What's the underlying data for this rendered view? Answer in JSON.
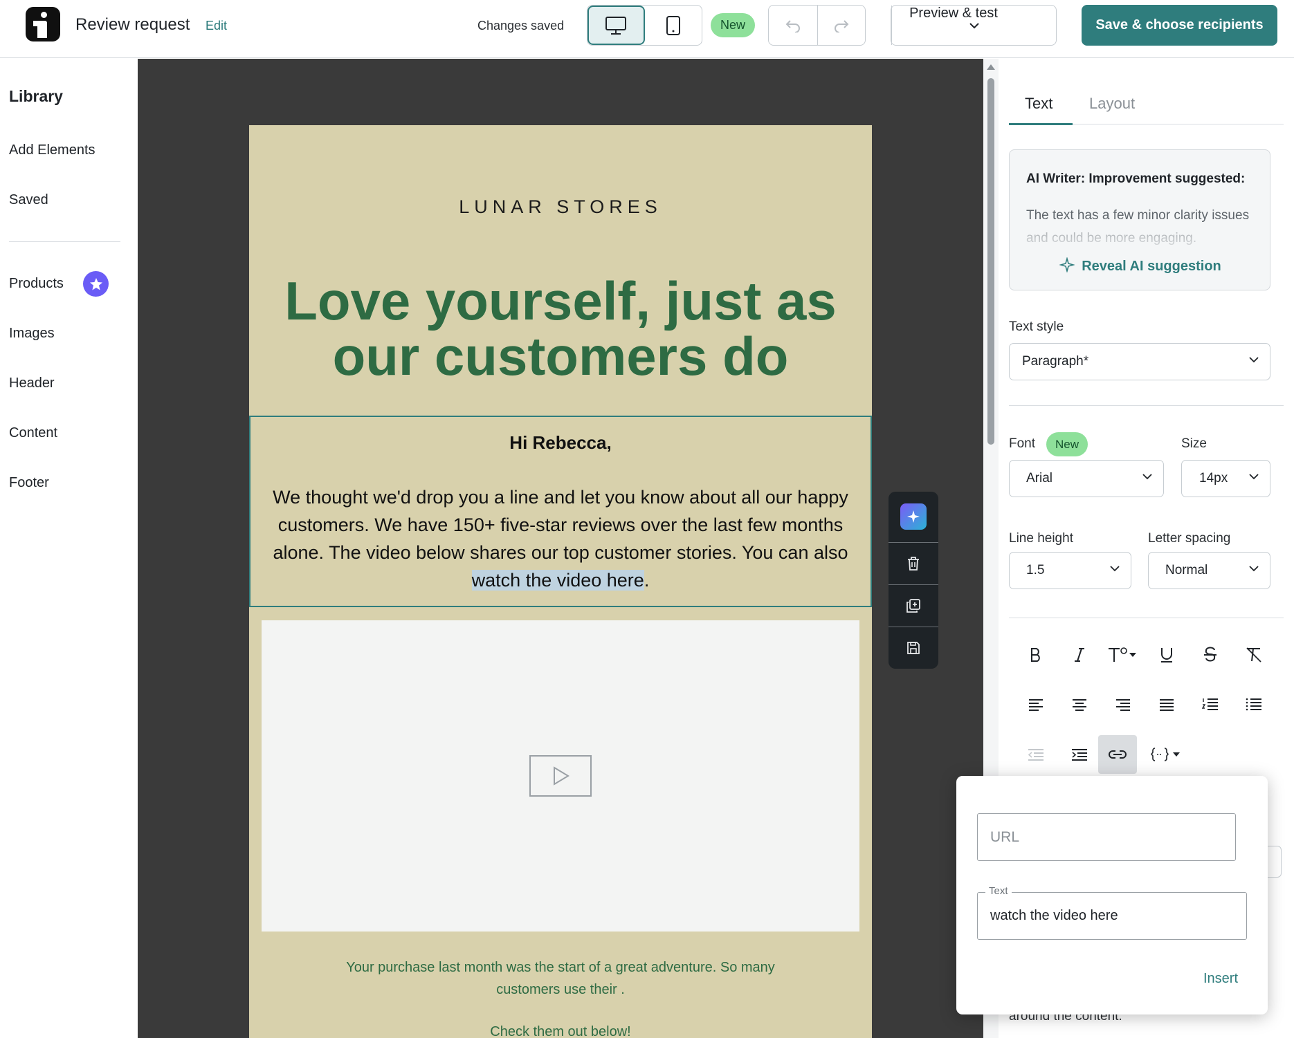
{
  "header": {
    "title": "Review request",
    "edit_label": "Edit",
    "status": "Changes saved",
    "new_badge": "New",
    "preview_label": "Preview & test",
    "save_label": "Save & choose recipients"
  },
  "sidebar": {
    "heading": "Library",
    "items": [
      "Add Elements",
      "Saved",
      "Products",
      "Images",
      "Header",
      "Content",
      "Footer"
    ]
  },
  "email": {
    "brand": "LUNAR STORES",
    "headline_line1": "Love yourself, just as",
    "headline_line2": "our customers do",
    "greeting": "Hi Rebecca,",
    "body_before": "We thought we'd drop you a line and let you know about all our happy customers. We have 150+ five-star reviews over the last few months alone. The video below shares our top customer stories. You can also ",
    "body_link": "watch the video here",
    "body_after": ".",
    "footer_text": "Your purchase last month was the start of a great adventure. So many customers use their .",
    "footer_cta": "Check them out below!"
  },
  "panel": {
    "tab_text": "Text",
    "tab_layout": "Layout",
    "ai_title": "AI Writer: Improvement suggested:",
    "ai_body": "The text has a few minor clarity issues and could be more engaging.",
    "ai_reveal": "Reveal AI suggestion",
    "text_style_label": "Text style",
    "text_style_value": "Paragraph*",
    "font_label": "Font",
    "font_new": "New",
    "font_value": "Arial",
    "size_label": "Size",
    "size_value": "14px",
    "line_height_label": "Line height",
    "line_height_value": "1.5",
    "letter_spacing_label": "Letter spacing",
    "letter_spacing_value": "Normal",
    "hint_below": "around the content."
  },
  "link_popover": {
    "url_placeholder": "URL",
    "text_label": "Text",
    "text_value": "watch the video here",
    "insert_label": "Insert"
  },
  "colors": {
    "accent": "#2f7d7d",
    "headline_green": "#2e6b43",
    "email_bg": "#d8d1ac",
    "canvas_bg": "#3a3a3a"
  }
}
